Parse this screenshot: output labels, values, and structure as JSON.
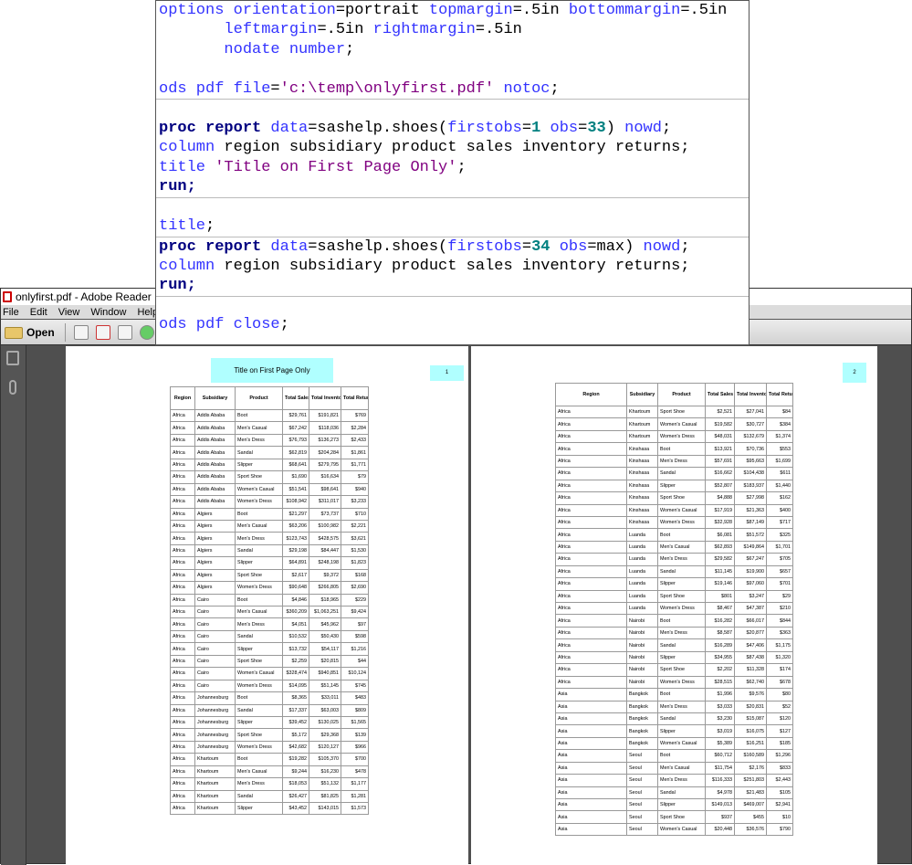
{
  "colors": {
    "keyword": "#3333ff",
    "proc": "#000080",
    "number": "#008080",
    "string": "#800080",
    "title_box": "#b0ffff"
  },
  "code": {
    "lines": [
      [
        [
          "options ",
          "kw"
        ],
        [
          "orientation",
          "kw"
        ],
        [
          "=portrait ",
          "pl"
        ],
        [
          "topmargin",
          "kw"
        ],
        [
          "=.5in ",
          "pl"
        ],
        [
          "bottommargin",
          "kw"
        ],
        [
          "=.5in",
          "pl"
        ]
      ],
      [
        [
          "       leftmargin",
          "kw"
        ],
        [
          "=.5in ",
          "pl"
        ],
        [
          "rightmargin",
          "kw"
        ],
        [
          "=.5in",
          "pl"
        ]
      ],
      [
        [
          "       nodate number",
          "kw"
        ],
        [
          ";",
          "pl"
        ]
      ],
      [],
      [
        [
          "ods pdf file",
          "kw"
        ],
        [
          "=",
          "pl"
        ],
        [
          "'c:\\temp\\onlyfirst.pdf'",
          "st"
        ],
        [
          " notoc",
          "kw"
        ],
        [
          ";",
          "pl"
        ]
      ],
      [],
      [
        [
          "proc report",
          "pr"
        ],
        [
          " data",
          "kw"
        ],
        [
          "=sashelp.shoes(",
          "pl"
        ],
        [
          "firstobs",
          "kw"
        ],
        [
          "=",
          "pl"
        ],
        [
          "1",
          "nu"
        ],
        [
          " obs",
          "kw"
        ],
        [
          "=",
          "pl"
        ],
        [
          "33",
          "nu"
        ],
        [
          ") ",
          "pl"
        ],
        [
          "nowd",
          "kw"
        ],
        [
          ";",
          "pl"
        ]
      ],
      [
        [
          "column",
          "kw"
        ],
        [
          " region subsidiary product sales inventory returns;",
          "pl"
        ]
      ],
      [
        [
          "title ",
          "kw"
        ],
        [
          "'Title on First Page Only'",
          "st"
        ],
        [
          ";",
          "pl"
        ]
      ],
      [
        [
          "run;",
          "pr"
        ]
      ],
      [],
      [
        [
          "title",
          "kw"
        ],
        [
          ";",
          "pl"
        ]
      ],
      [
        [
          "proc report",
          "pr"
        ],
        [
          " data",
          "kw"
        ],
        [
          "=sashelp.shoes(",
          "pl"
        ],
        [
          "firstobs",
          "kw"
        ],
        [
          "=",
          "pl"
        ],
        [
          "34",
          "nu"
        ],
        [
          " obs",
          "kw"
        ],
        [
          "=max) ",
          "pl"
        ],
        [
          "nowd",
          "kw"
        ],
        [
          ";",
          "pl"
        ]
      ],
      [
        [
          "column",
          "kw"
        ],
        [
          " region subsidiary product sales inventory returns;",
          "pl"
        ]
      ],
      [
        [
          "run;",
          "pr"
        ]
      ],
      [],
      [
        [
          "ods pdf close",
          "kw"
        ],
        [
          ";",
          "pl"
        ]
      ]
    ]
  },
  "window": {
    "title": "onlyfirst.pdf - Adobe Reader",
    "menu": [
      "File",
      "Edit",
      "View",
      "Window",
      "Help"
    ],
    "open_label": "Open"
  },
  "page1": {
    "title": "Title on First Page Only",
    "page_number": "1"
  },
  "page2": {
    "page_number": "2"
  },
  "columns": [
    "Region",
    "Subsidiary",
    "Product",
    "Total Sales",
    "Total Inventory",
    "Total Returns"
  ],
  "table1": [
    [
      "Africa",
      "Addis Ababa",
      "Boot",
      "$29,761",
      "$191,821",
      "$769"
    ],
    [
      "Africa",
      "Addis Ababa",
      "Men's Casual",
      "$67,242",
      "$118,036",
      "$2,284"
    ],
    [
      "Africa",
      "Addis Ababa",
      "Men's Dress",
      "$76,793",
      "$136,273",
      "$2,433"
    ],
    [
      "Africa",
      "Addis Ababa",
      "Sandal",
      "$62,819",
      "$204,284",
      "$1,861"
    ],
    [
      "Africa",
      "Addis Ababa",
      "Slipper",
      "$68,641",
      "$279,795",
      "$1,771"
    ],
    [
      "Africa",
      "Addis Ababa",
      "Sport Shoe",
      "$1,690",
      "$16,634",
      "$79"
    ],
    [
      "Africa",
      "Addis Ababa",
      "Women's Casual",
      "$51,541",
      "$98,641",
      "$940"
    ],
    [
      "Africa",
      "Addis Ababa",
      "Women's Dress",
      "$108,942",
      "$311,017",
      "$3,233"
    ],
    [
      "Africa",
      "Algiers",
      "Boot",
      "$21,297",
      "$73,737",
      "$710"
    ],
    [
      "Africa",
      "Algiers",
      "Men's Casual",
      "$63,206",
      "$100,982",
      "$2,221"
    ],
    [
      "Africa",
      "Algiers",
      "Men's Dress",
      "$123,743",
      "$428,575",
      "$3,621"
    ],
    [
      "Africa",
      "Algiers",
      "Sandal",
      "$29,198",
      "$84,447",
      "$1,530"
    ],
    [
      "Africa",
      "Algiers",
      "Slipper",
      "$64,891",
      "$248,198",
      "$1,823"
    ],
    [
      "Africa",
      "Algiers",
      "Sport Shoe",
      "$2,617",
      "$9,372",
      "$168"
    ],
    [
      "Africa",
      "Algiers",
      "Women's Dress",
      "$90,648",
      "$266,805",
      "$2,690"
    ],
    [
      "Africa",
      "Cairo",
      "Boot",
      "$4,846",
      "$18,965",
      "$229"
    ],
    [
      "Africa",
      "Cairo",
      "Men's Casual",
      "$360,209",
      "$1,063,251",
      "$9,424"
    ],
    [
      "Africa",
      "Cairo",
      "Men's Dress",
      "$4,051",
      "$45,962",
      "$97"
    ],
    [
      "Africa",
      "Cairo",
      "Sandal",
      "$10,532",
      "$50,430",
      "$598"
    ],
    [
      "Africa",
      "Cairo",
      "Slipper",
      "$13,732",
      "$54,117",
      "$1,216"
    ],
    [
      "Africa",
      "Cairo",
      "Sport Shoe",
      "$2,259",
      "$20,815",
      "$44"
    ],
    [
      "Africa",
      "Cairo",
      "Women's Casual",
      "$328,474",
      "$940,851",
      "$10,124"
    ],
    [
      "Africa",
      "Cairo",
      "Women's Dress",
      "$14,095",
      "$51,145",
      "$745"
    ],
    [
      "Africa",
      "Johannesburg",
      "Boot",
      "$8,365",
      "$33,011",
      "$483"
    ],
    [
      "Africa",
      "Johannesburg",
      "Sandal",
      "$17,337",
      "$63,003",
      "$809"
    ],
    [
      "Africa",
      "Johannesburg",
      "Slipper",
      "$39,452",
      "$130,025",
      "$1,565"
    ],
    [
      "Africa",
      "Johannesburg",
      "Sport Shoe",
      "$5,172",
      "$29,368",
      "$139"
    ],
    [
      "Africa",
      "Johannesburg",
      "Women's Dress",
      "$42,682",
      "$120,127",
      "$966"
    ],
    [
      "Africa",
      "Khartoum",
      "Boot",
      "$19,282",
      "$105,370",
      "$700"
    ],
    [
      "Africa",
      "Khartoum",
      "Men's Casual",
      "$9,244",
      "$16,230",
      "$478"
    ],
    [
      "Africa",
      "Khartoum",
      "Men's Dress",
      "$18,053",
      "$51,132",
      "$1,177"
    ],
    [
      "Africa",
      "Khartoum",
      "Sandal",
      "$26,427",
      "$81,825",
      "$1,281"
    ],
    [
      "Africa",
      "Khartoum",
      "Slipper",
      "$43,452",
      "$143,015",
      "$1,573"
    ]
  ],
  "table2": [
    [
      "Africa",
      "Khartoum",
      "Sport Shoe",
      "$2,521",
      "$27,041",
      "$84"
    ],
    [
      "Africa",
      "Khartoum",
      "Women's Casual",
      "$19,582",
      "$30,727",
      "$384"
    ],
    [
      "Africa",
      "Khartoum",
      "Women's Dress",
      "$48,031",
      "$132,679",
      "$1,374"
    ],
    [
      "Africa",
      "Kinshasa",
      "Boot",
      "$13,921",
      "$70,736",
      "$553"
    ],
    [
      "Africa",
      "Kinshasa",
      "Men's Dress",
      "$57,691",
      "$95,663",
      "$1,699"
    ],
    [
      "Africa",
      "Kinshasa",
      "Sandal",
      "$16,662",
      "$104,438",
      "$611"
    ],
    [
      "Africa",
      "Kinshasa",
      "Slipper",
      "$52,807",
      "$183,937",
      "$1,440"
    ],
    [
      "Africa",
      "Kinshasa",
      "Sport Shoe",
      "$4,888",
      "$27,998",
      "$162"
    ],
    [
      "Africa",
      "Kinshasa",
      "Women's Casual",
      "$17,919",
      "$21,363",
      "$400"
    ],
    [
      "Africa",
      "Kinshasa",
      "Women's Dress",
      "$32,928",
      "$87,149",
      "$717"
    ],
    [
      "Africa",
      "Luanda",
      "Boot",
      "$6,081",
      "$51,572",
      "$325"
    ],
    [
      "Africa",
      "Luanda",
      "Men's Casual",
      "$62,893",
      "$149,864",
      "$1,701"
    ],
    [
      "Africa",
      "Luanda",
      "Men's Dress",
      "$29,582",
      "$67,247",
      "$705"
    ],
    [
      "Africa",
      "Luanda",
      "Sandal",
      "$11,145",
      "$19,900",
      "$657"
    ],
    [
      "Africa",
      "Luanda",
      "Slipper",
      "$19,146",
      "$97,060",
      "$701"
    ],
    [
      "Africa",
      "Luanda",
      "Sport Shoe",
      "$801",
      "$3,247",
      "$29"
    ],
    [
      "Africa",
      "Luanda",
      "Women's Dress",
      "$8,467",
      "$47,387",
      "$210"
    ],
    [
      "Africa",
      "Nairobi",
      "Boot",
      "$16,282",
      "$66,017",
      "$844"
    ],
    [
      "Africa",
      "Nairobi",
      "Men's Dress",
      "$8,587",
      "$20,877",
      "$363"
    ],
    [
      "Africa",
      "Nairobi",
      "Sandal",
      "$16,289",
      "$47,406",
      "$1,175"
    ],
    [
      "Africa",
      "Nairobi",
      "Slipper",
      "$34,955",
      "$87,438",
      "$1,320"
    ],
    [
      "Africa",
      "Nairobi",
      "Sport Shoe",
      "$2,202",
      "$11,328",
      "$174"
    ],
    [
      "Africa",
      "Nairobi",
      "Women's Dress",
      "$28,515",
      "$62,740",
      "$678"
    ],
    [
      "Asia",
      "Bangkok",
      "Boot",
      "$1,996",
      "$9,576",
      "$80"
    ],
    [
      "Asia",
      "Bangkok",
      "Men's Dress",
      "$3,033",
      "$20,831",
      "$52"
    ],
    [
      "Asia",
      "Bangkok",
      "Sandal",
      "$3,230",
      "$15,087",
      "$120"
    ],
    [
      "Asia",
      "Bangkok",
      "Slipper",
      "$3,019",
      "$16,075",
      "$127"
    ],
    [
      "Asia",
      "Bangkok",
      "Women's Casual",
      "$5,389",
      "$16,251",
      "$185"
    ],
    [
      "Asia",
      "Seoul",
      "Boot",
      "$60,712",
      "$160,589",
      "$1,296"
    ],
    [
      "Asia",
      "Seoul",
      "Men's Casual",
      "$11,754",
      "$2,176",
      "$833"
    ],
    [
      "Asia",
      "Seoul",
      "Men's Dress",
      "$116,333",
      "$251,803",
      "$2,443"
    ],
    [
      "Asia",
      "Seoul",
      "Sandal",
      "$4,978",
      "$21,483",
      "$105"
    ],
    [
      "Asia",
      "Seoul",
      "Slipper",
      "$149,013",
      "$469,007",
      "$2,941"
    ],
    [
      "Asia",
      "Seoul",
      "Sport Shoe",
      "$937",
      "$455",
      "$10"
    ],
    [
      "Asia",
      "Seoul",
      "Women's Casual",
      "$20,448",
      "$36,576",
      "$790"
    ]
  ]
}
